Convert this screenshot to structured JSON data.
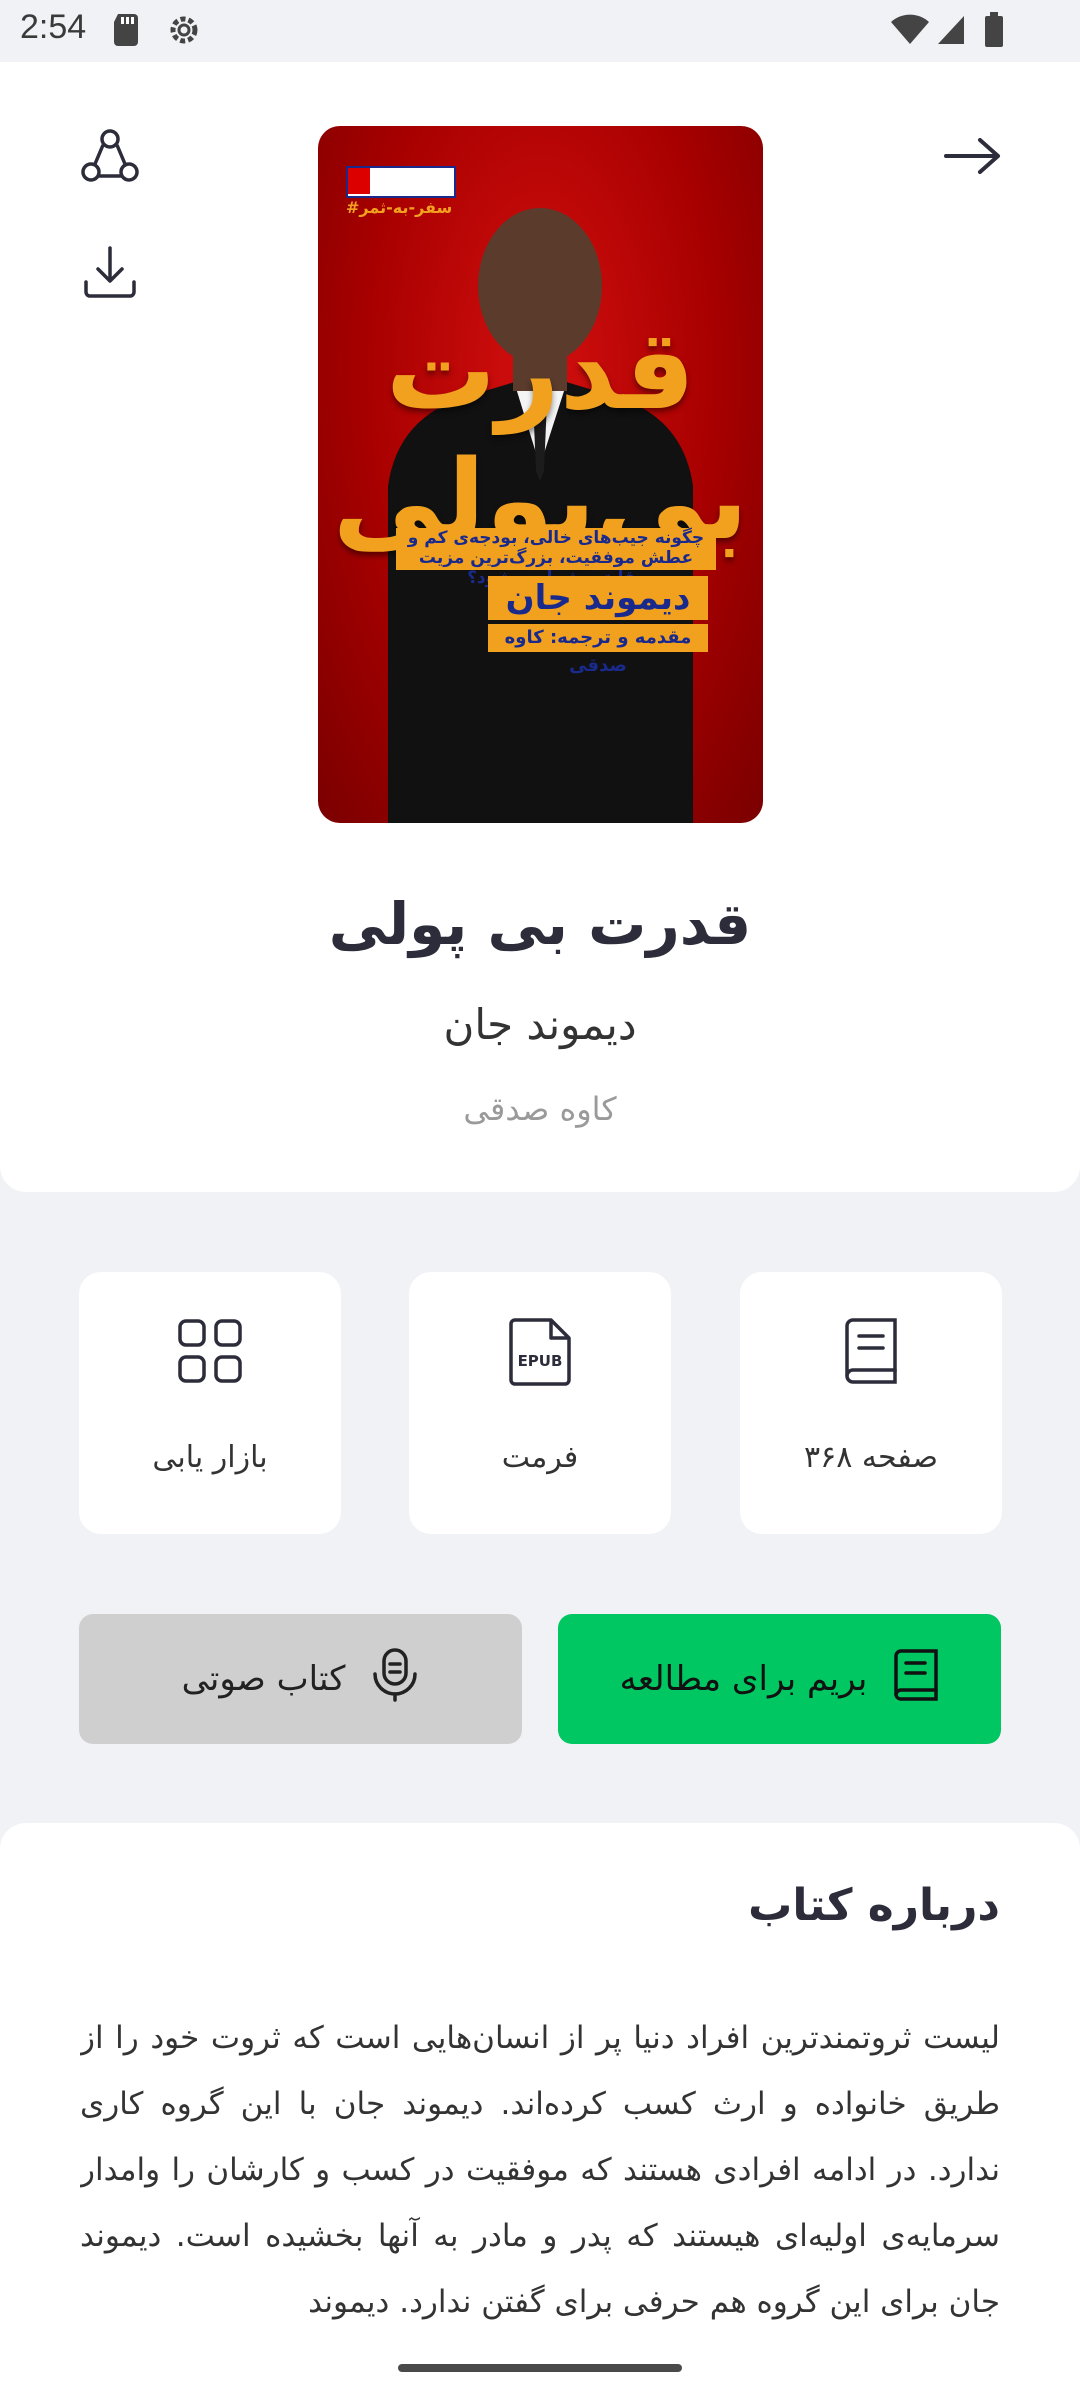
{
  "status_bar": {
    "time": "2:54"
  },
  "header": {
    "share_icon": "share-icon",
    "download_icon": "download-icon",
    "back_icon": "arrow-right-icon"
  },
  "cover": {
    "title_line1": "قدرت",
    "title_line2": "بی‌پولی",
    "series_tag": "#سفر-به-ثمر",
    "subtitle": "چگونه جیب‌های خالی، بودجه‌ی کم و عطش موفقیت، بزرگ‌ترین مزیت رقابتی شما می‌شود؟",
    "author": "دیموند جان",
    "translator": "مقدمه و ترجمه: کاوه صدقی"
  },
  "book": {
    "title": "قدرت بی پولی",
    "author": "دیموند جان",
    "translator": "کاوه صدقی"
  },
  "info_cards": {
    "pages": "۳۶۸ صفحه",
    "format": "فرمت",
    "format_icon_text": "EPUB",
    "category": "بازار یابی"
  },
  "actions": {
    "read": "بریم برای مطالعه",
    "audio": "کتاب صوتی"
  },
  "about": {
    "title": "درباره کتاب",
    "body": "لیست ثروتمندترین افراد دنیا پر از انسان‌هایی است که ثروت خود را از طریق خانواده و ارث کسب کرده‌اند. دیموند جان با این گروه کاری ندارد. در ادامه افرادی هستند که موفقیت در کسب و کارشان را وامدار سرمایه‌ی اولیه‌ای هیستند که پدر و مادر به آنها بخشیده است. دیموند جان برای این گروه هم حرفی برای گفتن ندارد. دیموند"
  },
  "colors": {
    "accent_green": "#00c762",
    "audio_button_bg": "#cfcfcf",
    "cover_red": "#b00000",
    "cover_gold": "#f2a11f"
  }
}
